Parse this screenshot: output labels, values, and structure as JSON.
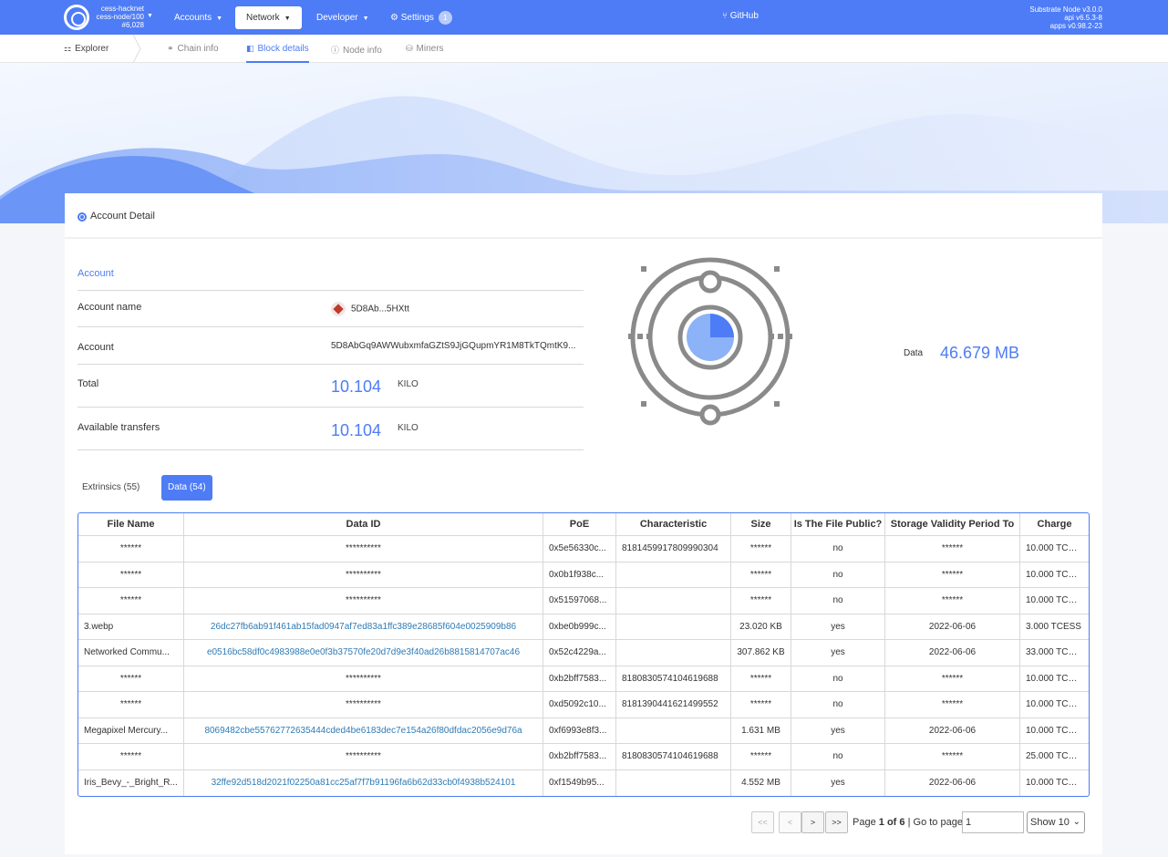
{
  "header": {
    "chain_name": "cess-hacknet",
    "node_name": "cess-node/100",
    "block": "#6,028",
    "nav": [
      {
        "label": "Accounts"
      },
      {
        "label": "Network"
      },
      {
        "label": "Developer"
      },
      {
        "label": "Settings",
        "badge": "1"
      }
    ],
    "github": "GitHub",
    "versions": [
      "Substrate Node v3.0.0",
      "api v6.5.3-8",
      "apps v0.98.2-23"
    ]
  },
  "subnav": {
    "explorer": "Explorer",
    "tabs": [
      "Chain info",
      "Block details",
      "Node info",
      "Miners"
    ],
    "active_tab": "Block details"
  },
  "panel": {
    "title": "Account Detail",
    "account_header": "Account",
    "rows": {
      "account_name_label": "Account name",
      "account_name_value": "5D8Ab...5HXtt",
      "account_label": "Account",
      "account_value": "5D8AbGq9AWWubxmfaGZtS9JjGQupmYR1M8TkTQmtK9...",
      "total_label": "Total",
      "total_value": "10.104",
      "total_unit": "KILO",
      "available_label": "Available transfers",
      "available_value": "10.104",
      "available_unit": "KILO"
    },
    "data_label": "Data",
    "data_value": "46.679 MB",
    "tabs": [
      {
        "label": "Extrinsics (55)",
        "active": false
      },
      {
        "label": "Data (54)",
        "active": true
      }
    ]
  },
  "table": {
    "columns": [
      "File Name",
      "Data ID",
      "PoE",
      "Characteristic",
      "Size",
      "Is The File Public?",
      "Storage Validity Period To",
      "Charge"
    ],
    "rows": [
      [
        "******",
        "**********",
        "0x5e56330c...",
        "8181459917809990304",
        "******",
        "no",
        "******",
        "10.000 TCESS"
      ],
      [
        "******",
        "**********",
        "0x0b1f938c...",
        "",
        "******",
        "no",
        "******",
        "10.000 TCESS"
      ],
      [
        "******",
        "**********",
        "0x51597068...",
        "",
        "******",
        "no",
        "******",
        "10.000 TCESS"
      ],
      [
        "3.webp",
        "26dc27fb6ab91f461ab15fad0947af7ed83a1ffc389e28685f604e0025909b86",
        "0xbe0b999c...",
        "",
        "23.020 KB",
        "yes",
        "2022-06-06",
        "3.000 TCESS"
      ],
      [
        "Networked Commu...",
        "e0516bc58df0c4983988e0e0f3b37570fe20d7d9e3f40ad26b8815814707ac46",
        "0x52c4229a...",
        "",
        "307.862 KB",
        "yes",
        "2022-06-06",
        "33.000 TCESS"
      ],
      [
        "******",
        "**********",
        "0xb2bff7583...",
        "8180830574104619688",
        "******",
        "no",
        "******",
        "10.000 TCESS"
      ],
      [
        "******",
        "**********",
        "0xd5092c10...",
        "8181390441621499552",
        "******",
        "no",
        "******",
        "10.000 TCESS"
      ],
      [
        "Megapixel Mercury...",
        "8069482cbe55762772635444cded4be6183dec7e154a26f80dfdac2056e9d76a",
        "0xf6993e8f3...",
        "",
        "1.631 MB",
        "yes",
        "2022-06-06",
        "10.000 TCESS"
      ],
      [
        "******",
        "**********",
        "0xb2bff7583...",
        "8180830574104619688",
        "******",
        "no",
        "******",
        "25.000 TCESS"
      ],
      [
        "Iris_Bevy_-_Bright_R...",
        "32ffe92d518d2021f02250a81cc25af7f7b91196fa6b62d33cb0f4938b524101",
        "0xf1549b95...",
        "",
        "4.552 MB",
        "yes",
        "2022-06-06",
        "10.000 TCESS"
      ]
    ]
  },
  "pagination": {
    "first": "<<",
    "prev": "<",
    "next": ">",
    "last": ">>",
    "page_prefix": "Page",
    "current": "1",
    "of": "of",
    "total": "6",
    "goto_label": "| Go to page:",
    "goto_value": "1",
    "show": "Show 10"
  },
  "colors": {
    "primary": "#4e7cf6",
    "link": "#2f7bb6"
  }
}
